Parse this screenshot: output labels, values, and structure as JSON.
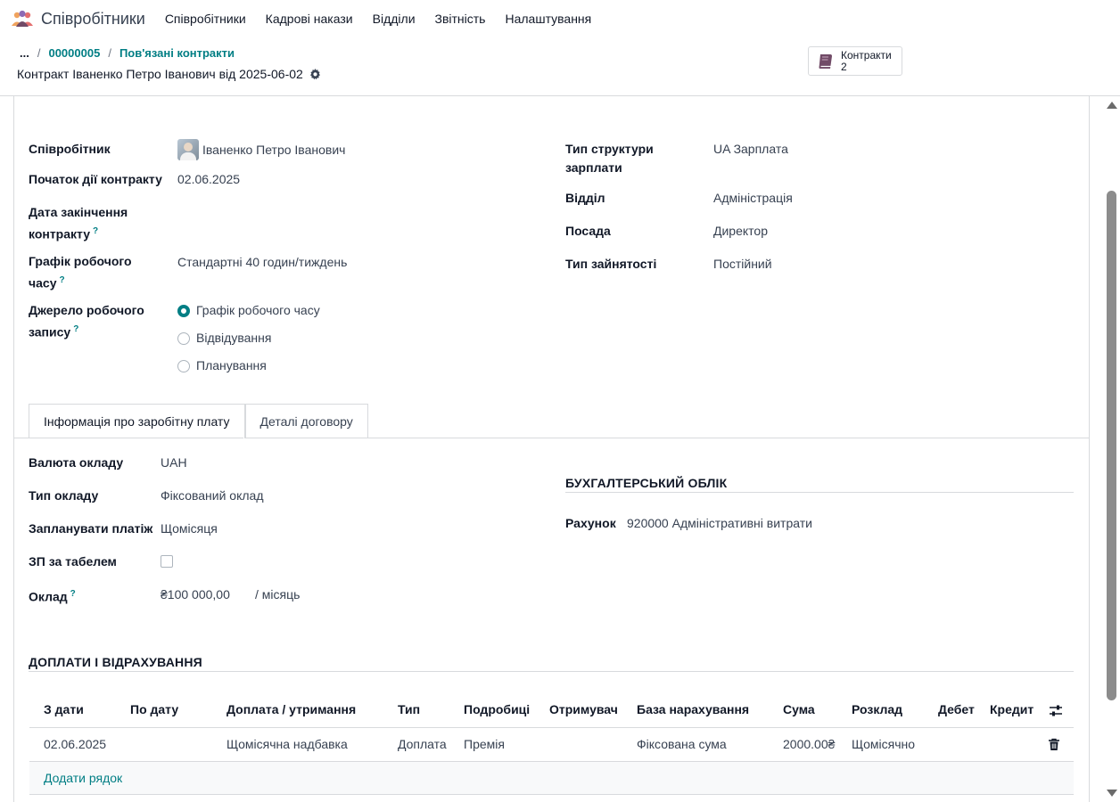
{
  "app": {
    "name": "Співробітники"
  },
  "menu": [
    "Співробітники",
    "Кадрові накази",
    "Відділи",
    "Звітність",
    "Налаштування"
  ],
  "breadcrumb": {
    "dots": "...",
    "sep": "/",
    "items": [
      "00000005",
      "Пов'язані контракти"
    ]
  },
  "record": {
    "title": "Контракт Іваненко Петро Іванович від 2025-06-02"
  },
  "stat_button": {
    "label": "Контракти",
    "count": "2"
  },
  "form": {
    "employee_label": "Співробітник",
    "employee_value": "Іваненко Петро Іванович",
    "start_label": "Початок дії контракту",
    "start_value": "02.06.2025",
    "end_label_1": "Дата закінчення",
    "end_label_2": "контракту",
    "schedule_label_1": "Графік робочого",
    "schedule_label_2": "часу",
    "schedule_value": "Стандартні 40 годин/тиждень",
    "source_label_1": "Джерело робочого",
    "source_label_2": "запису",
    "source_options": [
      "Графік робочого часу",
      "Відвідування",
      "Планування"
    ],
    "help_mark": "?",
    "struct_label_1": "Тип структури",
    "struct_label_2": "зарплати",
    "struct_value": "UA Зарплата",
    "dept_label": "Відділ",
    "dept_value": "Адміністрація",
    "job_label": "Посада",
    "job_value": "Директор",
    "emp_type_label": "Тип зайнятості",
    "emp_type_value": "Постійний"
  },
  "tabs": [
    "Інформація про заробітну плату",
    "Деталі договору"
  ],
  "salary": {
    "currency_label": "Валюта окладу",
    "currency_value": "UAH",
    "wage_type_label": "Тип окладу",
    "wage_type_value": "Фіксований оклад",
    "schedule_pay_label": "Запланувати платіж",
    "schedule_pay_value": "Щомісяця",
    "timesheet_label": "ЗП за табелем",
    "timesheet_checked": false,
    "wage_label": "Оклад",
    "wage_value": "₴100 000,00",
    "wage_period": "/ місяць"
  },
  "accounting": {
    "title": "БУХГАЛТЕРСЬКИЙ ОБЛІК",
    "account_label": "Рахунок",
    "account_value": "920000 Адміністративні витрати"
  },
  "lines": {
    "title": "ДОПЛАТИ І ВІДРАХУВАННЯ",
    "headers": [
      "З дати",
      "По дату",
      "Доплата / утримання",
      "Тип",
      "Подробиці",
      "Отримувач",
      "База нарахування",
      "Сума",
      "Розклад",
      "Дебет",
      "Кредит"
    ],
    "rows": [
      {
        "date_from": "02.06.2025",
        "date_to": "",
        "name": "Щомісячна надбавка",
        "type": "Доплата",
        "details": "Премія",
        "recipient": "",
        "base": "Фіксована сума",
        "amount": "2000.00₴",
        "schedule": "Щомісячно",
        "debit": "",
        "credit": ""
      }
    ],
    "add_line": "Додати рядок"
  },
  "colors": {
    "accent": "#017e84",
    "stat_icon": "#714b67"
  }
}
